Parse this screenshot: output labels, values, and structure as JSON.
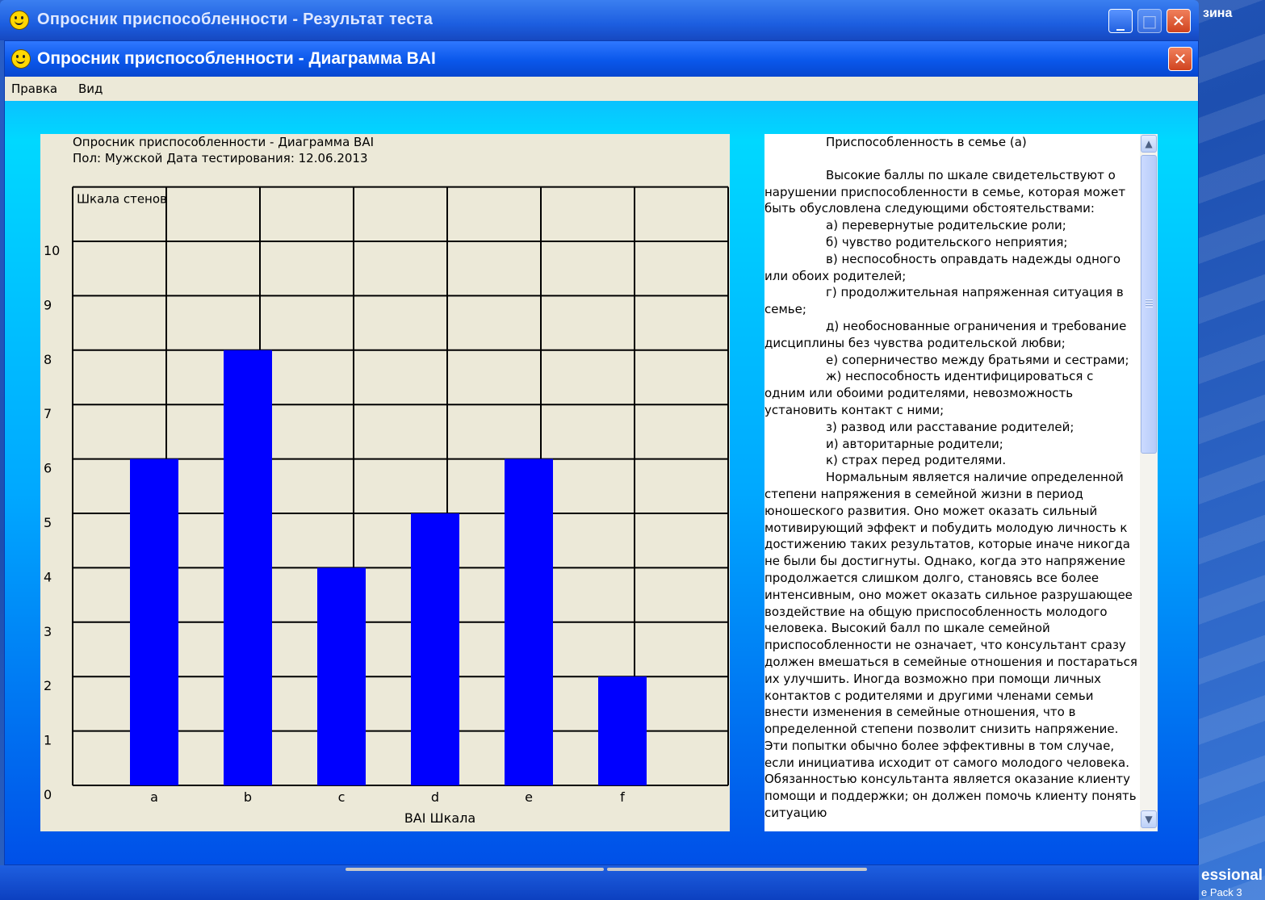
{
  "desktop": {
    "corner_top": "зина",
    "corner_bottom1": "essional",
    "corner_bottom2": "e Pack 3"
  },
  "back_window": {
    "title": "Опросник приспособленности - Результат теста"
  },
  "window": {
    "title": "Опросник приспособленности - Диаграмма BAI",
    "close_label": "✕",
    "minimize_label": "_",
    "maximize_label": "□"
  },
  "menu": {
    "items": [
      "Правка",
      "Вид"
    ]
  },
  "chart_header": {
    "line1": "Опросник приспособленности - Диаграмма BAI",
    "line2": "Пол: Мужской Дата тестирования: 12.06.2013"
  },
  "chart_data": {
    "type": "bar",
    "title": "Опросник приспособленности - Диаграмма BAI",
    "subtitle": "Пол: Мужской Дата тестирования: 12.06.2013",
    "xlabel": "BAI Шкала",
    "ylabel": "Шкала стенов",
    "categories": [
      "a",
      "b",
      "c",
      "d",
      "e",
      "f"
    ],
    "values": [
      6,
      8,
      4,
      5,
      6,
      2
    ],
    "yticks": [
      "0",
      "1",
      "2",
      "3",
      "4",
      "5",
      "6",
      "7",
      "8",
      "9",
      "10"
    ],
    "ylim": [
      0,
      11
    ],
    "grid": true,
    "bar_color": "#0000ff"
  },
  "description": {
    "title": "Приспособленность в семье (а)",
    "paragraphs": [
      "Высокие баллы по шкале свидетельствуют о нарушении приспособленности в семье, которая может быть обусловлена следующими обстоятельствами:",
      "а) перевернутые родительские роли;",
      "б) чувство родительского неприятия;",
      "в) неспособность оправдать надежды одного или обоих родителей;",
      "г) продолжительная напряженная ситуация в семье;",
      "д) необоснованные ограничения и требование дисциплины без чувства родительской любви;",
      "е) соперничество между братьями и сестрами;",
      "ж) неспособность идентифицироваться с одним или обоими родителями, невозможность установить контакт с ними;",
      "з) развод или расставание родителей;",
      "и) авторитарные родители;",
      "к) страх перед родителями.",
      "Нормальным является наличие определенной степени напряжения в семейной жизни в период юношеского развития. Оно может оказать сильный мотивирующий эффект и побудить молодую личность к достижению таких результатов, которые иначе никогда не были бы достигнуты. Однако, когда это напряжение продолжается слишком долго, становясь все более интенсивным, оно может оказать сильное разрушающее воздействие на общую приспособленность молодого человека. Высокий балл по шкале семейной приспособленности не означает, что консультант сразу должен вмешаться в семейные отношения и постараться их улучшить. Иногда возможно при помощи личных контактов с родителями и другими членами семьи внести изменения в семейные отношения, что в определенной степени позволит снизить напряжение. Эти попытки обычно более эффективны в том случае, если инициатива исходит от самого молодого человека. Обязанностью консультанта является оказание клиенту помощи и поддержки; он должен помочь клиенту понять ситуацию"
    ]
  },
  "scrollbar": {
    "up": "▲",
    "down": "▼"
  }
}
